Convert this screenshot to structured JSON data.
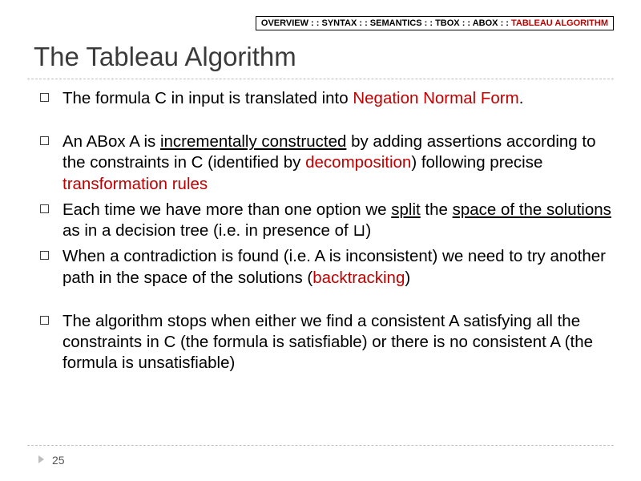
{
  "breadcrumb": {
    "items": [
      "OVERVIEW",
      "SYNTAX",
      "SEMANTICS",
      "TBOX",
      "ABOX",
      "TABLEAU ALGORITHM"
    ],
    "separator": " : : ",
    "active_index": 5
  },
  "title": "The Tableau Algorithm",
  "bullets": {
    "b1_pre": "The formula C in input is translated into ",
    "b1_nnf": "Negation Normal Form",
    "b1_post": ".",
    "b2_t1": "An ABox A is ",
    "b2_inc": "incrementally constructed",
    "b2_t2": " by adding assertions according to the constraints in C (identified by ",
    "b2_decomp": "decomposition",
    "b2_t3": ") following precise ",
    "b2_rules": "transformation rules",
    "b3_t1": "Each time we have more than one option we ",
    "b3_split": "split",
    "b3_t2": " the ",
    "b3_space": "space of the solutions",
    "b3_t3": " as in a decision tree (i.e. in presence of ",
    "b3_sym": "⊔",
    "b3_t4": ")",
    "b4_t1": "When a contradiction is found (i.e. A is inconsistent) we need to try another path in the space of the solutions (",
    "b4_bt": "backtracking",
    "b4_t2": ")",
    "b5": "The algorithm stops when either we find a consistent A satisfying all the constraints in C (the formula is satisfiable) or there is no consistent A (the formula is unsatisfiable)"
  },
  "footer": {
    "page": "25"
  }
}
